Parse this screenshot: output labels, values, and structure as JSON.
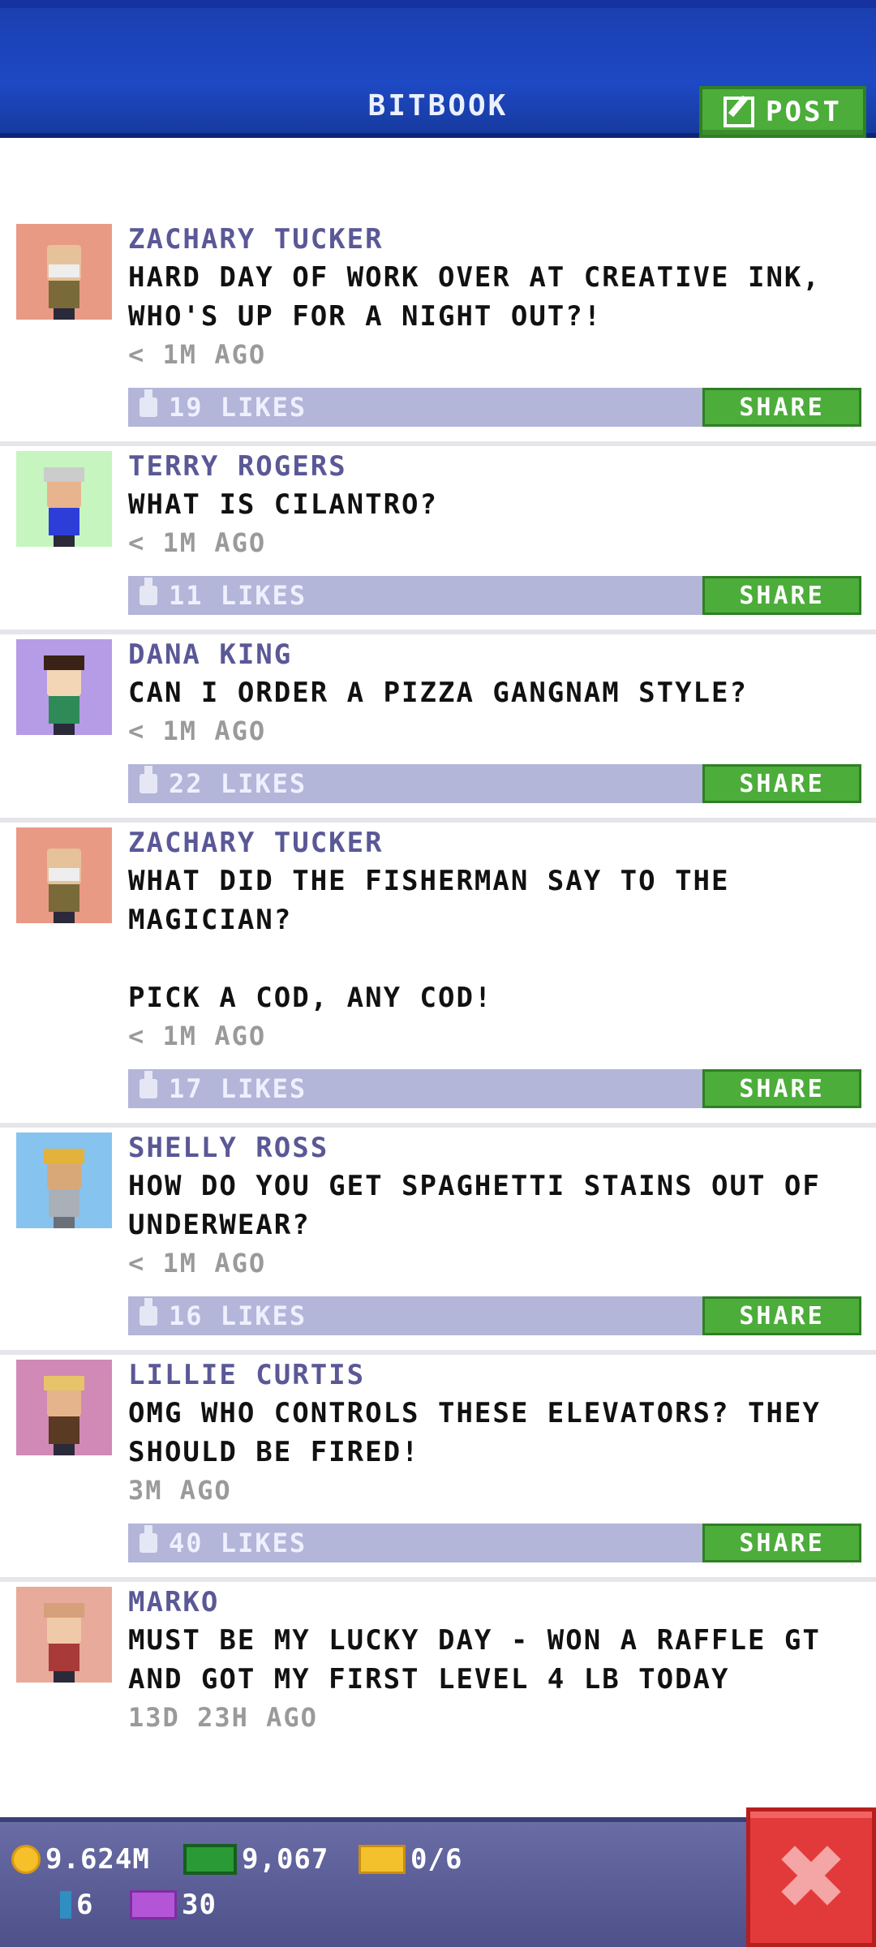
{
  "header": {
    "title": "BITBOOK",
    "post_label": "POST"
  },
  "share_label": "SHARE",
  "posts": [
    {
      "name": "ZACHARY TUCKER",
      "message": "HARD DAY OF WORK OVER AT CREATIVE INK, WHO'S UP FOR A NIGHT OUT?!",
      "time": "< 1M AGO",
      "likes": "19 LIKES",
      "avatar_bg": "#e99a85"
    },
    {
      "name": "TERRY ROGERS",
      "message": "WHAT IS CILANTRO?",
      "time": "< 1M AGO",
      "likes": "11 LIKES",
      "avatar_bg": "#c6f5c0"
    },
    {
      "name": "DANA KING",
      "message": "CAN I ORDER A PIZZA GANGNAM STYLE?",
      "time": "< 1M AGO",
      "likes": "22 LIKES",
      "avatar_bg": "#b69ce6"
    },
    {
      "name": "ZACHARY TUCKER",
      "message": "WHAT DID THE FISHERMAN SAY TO THE MAGICIAN?\n\nPICK A COD, ANY COD!",
      "time": "< 1M AGO",
      "likes": "17 LIKES",
      "avatar_bg": "#e99a85"
    },
    {
      "name": "SHELLY ROSS",
      "message": "HOW DO YOU GET SPAGHETTI STAINS OUT OF UNDERWEAR?",
      "time": "< 1M AGO",
      "likes": "16 LIKES",
      "avatar_bg": "#86c3ef"
    },
    {
      "name": "LILLIE CURTIS",
      "message": "OMG WHO CONTROLS THESE ELEVATORS? THEY SHOULD BE FIRED!",
      "time": "3M AGO",
      "likes": "40 LIKES",
      "avatar_bg": "#d08ab5"
    },
    {
      "name": "MARKO",
      "message": "MUST BE MY LUCKY DAY - WON A RAFFLE GT AND GOT MY FIRST LEVEL 4 LB TODAY",
      "time": "13D 23H AGO",
      "likes": "",
      "avatar_bg": "#e8aa9a"
    }
  ],
  "status": {
    "coins": "9.624M",
    "bux_cash": "9,067",
    "tickets": "0/6",
    "bitizens": "6",
    "vip": "30"
  }
}
